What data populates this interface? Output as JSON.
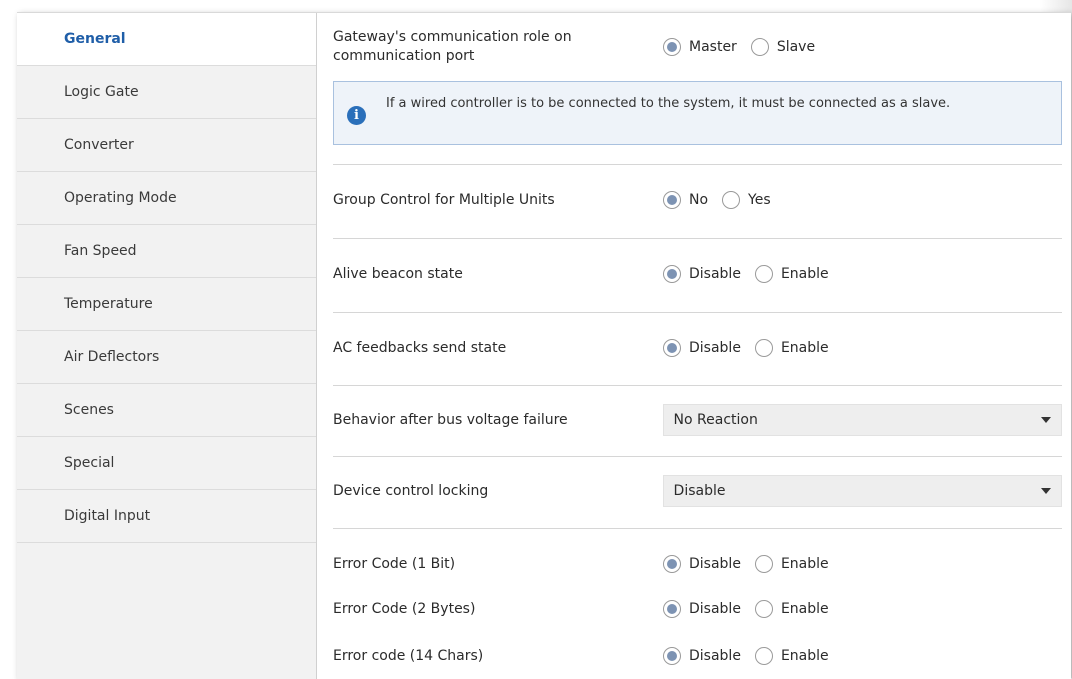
{
  "sidebar": {
    "items": [
      {
        "label": "General"
      },
      {
        "label": "Logic Gate"
      },
      {
        "label": "Converter"
      },
      {
        "label": "Operating Mode"
      },
      {
        "label": "Fan Speed"
      },
      {
        "label": "Temperature"
      },
      {
        "label": "Air Deflectors"
      },
      {
        "label": "Scenes"
      },
      {
        "label": "Special"
      },
      {
        "label": "Digital Input"
      }
    ],
    "active": "General"
  },
  "settings": {
    "comm_role": {
      "label": "Gateway's communication role on communication port",
      "options": [
        "Master",
        "Slave"
      ],
      "selected": "Master"
    },
    "info": {
      "icon": "info-icon",
      "text": "If a wired controller is to be connected to the system, it must be connected as a slave."
    },
    "group_control": {
      "label": "Group Control for Multiple Units",
      "options": [
        "No",
        "Yes"
      ],
      "selected": "No"
    },
    "alive_beacon": {
      "label": "Alive beacon state",
      "options": [
        "Disable",
        "Enable"
      ],
      "selected": "Disable"
    },
    "ac_feedbacks": {
      "label": "AC feedbacks send state",
      "options": [
        "Disable",
        "Enable"
      ],
      "selected": "Disable"
    },
    "bus_voltage": {
      "label": "Behavior after bus voltage failure",
      "value": "No Reaction"
    },
    "device_locking": {
      "label": "Device control locking",
      "value": "Disable"
    },
    "error_1bit": {
      "label": "Error Code (1 Bit)",
      "options": [
        "Disable",
        "Enable"
      ],
      "selected": "Disable"
    },
    "error_2bytes": {
      "label": "Error Code (2 Bytes)",
      "options": [
        "Disable",
        "Enable"
      ],
      "selected": "Disable"
    },
    "error_14chars": {
      "label": "Error code (14 Chars)",
      "options": [
        "Disable",
        "Enable"
      ],
      "selected": "Disable"
    }
  },
  "colors": {
    "accent": "#1f5ea8",
    "radio_fill": "#7d93b3",
    "info_bg": "#eef3f9",
    "info_border": "#a9c1df",
    "sidebar_bg": "#f2f2f2"
  }
}
